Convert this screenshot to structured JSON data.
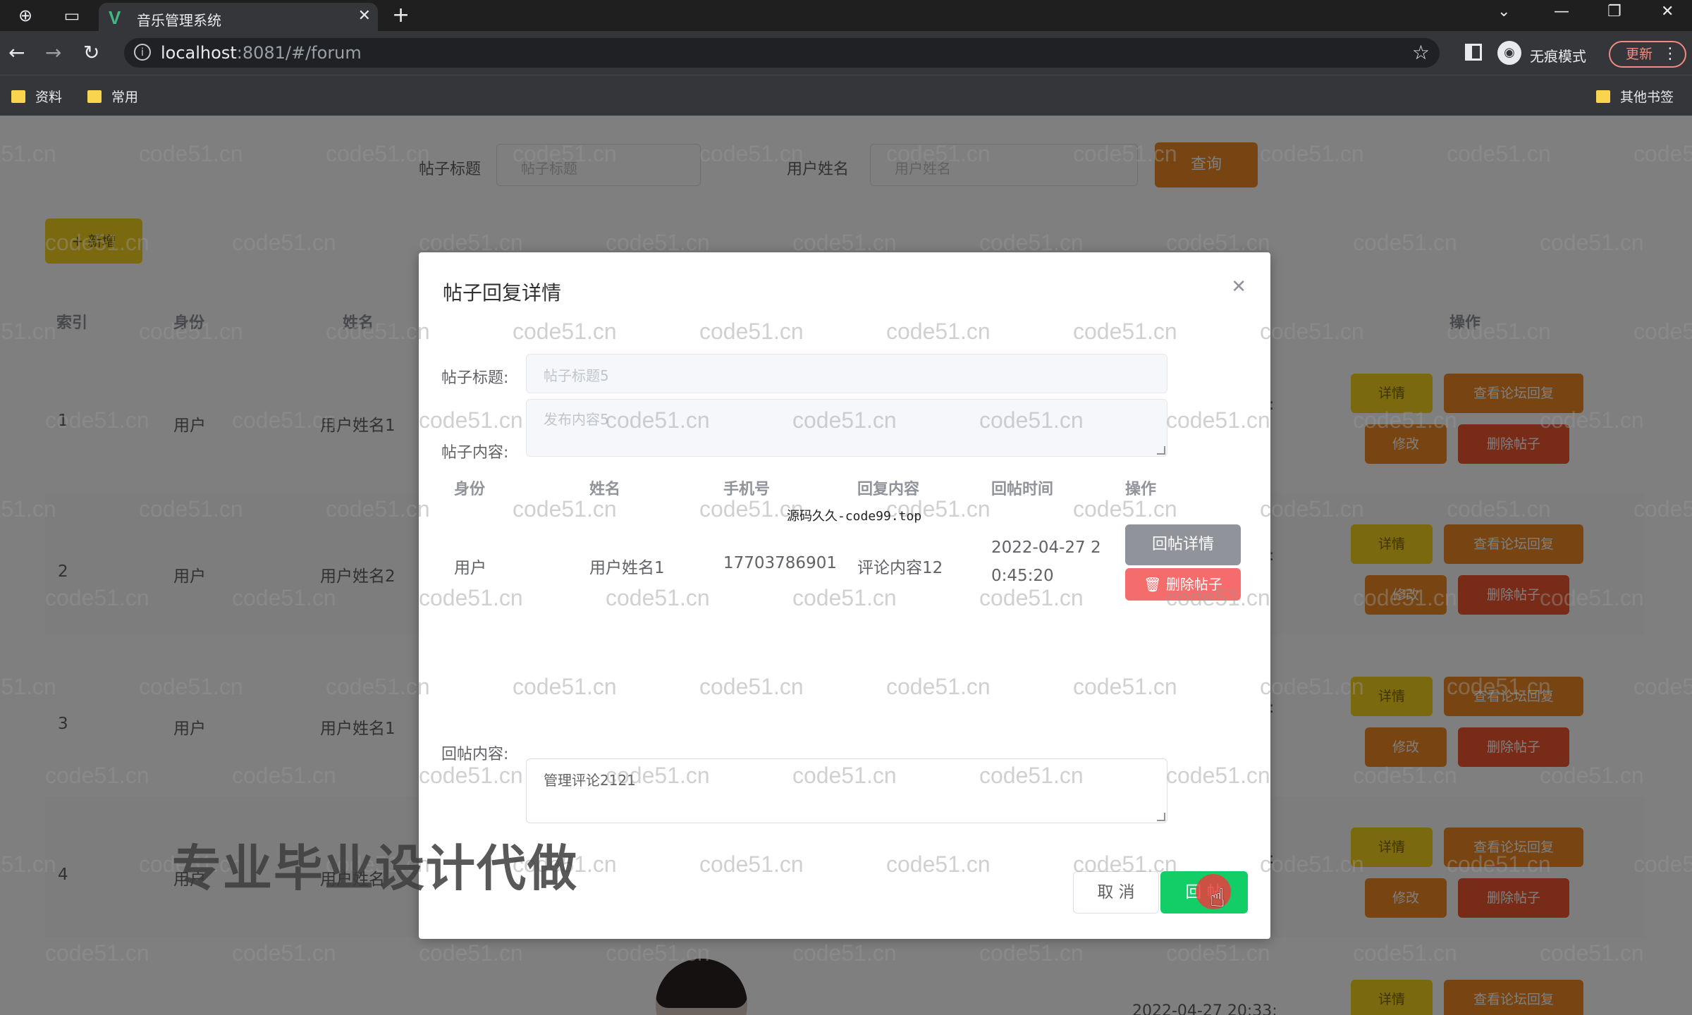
{
  "browser": {
    "tab_title": "音乐管理系统",
    "url_host": "localhost",
    "url_rest": ":8081/#/forum",
    "incognito_label": "无痕模式",
    "update_label": "更新",
    "bookmarks": [
      "资料",
      "常用"
    ],
    "other_bookmarks": "其他书签"
  },
  "search": {
    "title_label": "帖子标题",
    "title_placeholder": "帖子标题",
    "user_label": "用户姓名",
    "user_placeholder": "用户姓名",
    "query_button": "查询"
  },
  "add_button": "+ 新增",
  "table": {
    "headers": {
      "index": "索引",
      "role": "身份",
      "name": "姓名",
      "actions": "操作"
    },
    "rows": [
      {
        "index": "1",
        "role": "用户",
        "name": "用户姓名1"
      },
      {
        "index": "2",
        "role": "用户",
        "name": "用户姓名2"
      },
      {
        "index": "3",
        "role": "用户",
        "name": "用户姓名1"
      },
      {
        "index": "4",
        "role": "用户",
        "name": "用户姓名"
      }
    ],
    "actions": {
      "detail": "详情",
      "view_replies": "查看论坛回复",
      "edit": "修改",
      "delete": "删除帖子"
    },
    "bottom_time": "2022-04-27 20:33:"
  },
  "dialog": {
    "title": "帖子回复详情",
    "title_label": "帖子标题:",
    "title_value": "帖子标题5",
    "content_label": "帖子内容:",
    "content_value": "发布内容5",
    "reply_table": {
      "headers": [
        "身份",
        "姓名",
        "手机号",
        "回复内容",
        "回帖时间",
        "操作"
      ],
      "row": {
        "role": "用户",
        "name": "用户姓名1",
        "phone": "17703786901",
        "content": "评论内容12",
        "time_line1": "2022-04-27 2",
        "time_line2": "0:45:20"
      },
      "reply_detail_button": "回帖详情",
      "delete_button": "删除帖子"
    },
    "reply_label": "回帖内容:",
    "reply_value": "管理评论2121",
    "cancel_button": "取 消",
    "submit_button": "回 帖"
  },
  "overlays": {
    "watermark": "code51.cn",
    "mid_watermark": "源码久久-code99.top",
    "promo": "专业毕业设计代做"
  },
  "colors": {
    "query": "#f08a24",
    "add": "#f5d21f",
    "delete": "#f56c6c",
    "submit": "#13ce66",
    "reply_detail": "#909399"
  }
}
